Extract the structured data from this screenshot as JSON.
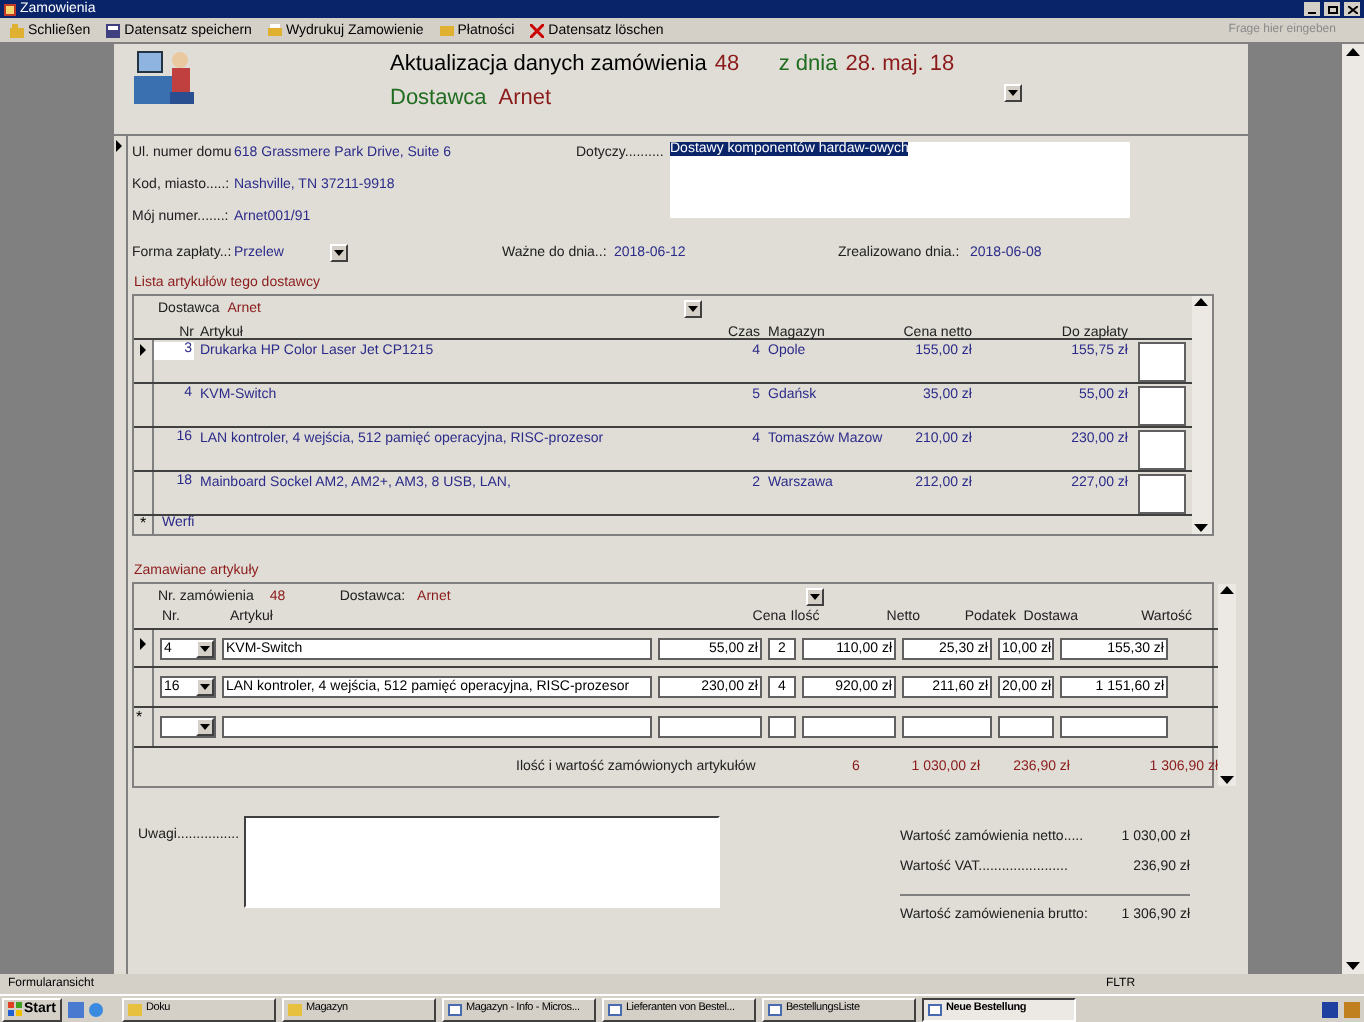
{
  "window": {
    "title": "Zamowienia"
  },
  "toolbar": {
    "buttons": [
      {
        "label": "Schließen"
      },
      {
        "label": "Datensatz speichern"
      },
      {
        "label": "Wydrukuj Zamowienie"
      },
      {
        "label": "Płatności"
      },
      {
        "label": "Datensatz löschen"
      }
    ],
    "help_placeholder": "Frage hier eingeben"
  },
  "header": {
    "title_label": "Aktualizacja danych zamówienia",
    "order_number": "48",
    "date_label": "z dnia",
    "date": "28. maj. 18",
    "supplier_label": "Dostawca",
    "supplier": "Arnet"
  },
  "fields": {
    "street": {
      "label": "Ul. numer domu",
      "value": "618 Grassmere Park Drive, Suite 6"
    },
    "city": {
      "label": "Kod, miasto.....:",
      "value": "Nashville, TN 37211-9918"
    },
    "my_number": {
      "label": "Mój numer.......:",
      "value": "Arnet001/91"
    },
    "subject": {
      "label": "Dotyczy..........",
      "value": "Dostawy komponentów hardaw-owych"
    },
    "payment": {
      "label": "Forma zapłaty..:",
      "value": "Przelew"
    },
    "valid_until": {
      "label": "Ważne do dnia..:",
      "value": "2018-06-12"
    },
    "realized": {
      "label": "Zrealizowano dnia.:",
      "value": "2018-06-08"
    }
  },
  "supplier_articles": {
    "title": "Lista artykułów tego dostawcy",
    "supplier_label": "Dostawca",
    "supplier": "Arnet",
    "columns": [
      "Nr",
      "Artykuł",
      "Czas",
      "Magazyn",
      "Cena netto",
      "Do zapłaty"
    ],
    "rows": [
      {
        "nr": "3",
        "article": "Drukarka HP Color Laser Jet CP1215",
        "time": "4",
        "warehouse": "Opole",
        "net": "155,00 zł",
        "gross": "155,75 zł",
        "selected": true
      },
      {
        "nr": "4",
        "article": "KVM-Switch",
        "time": "5",
        "warehouse": "Gdańsk",
        "net": "35,00 zł",
        "gross": "55,00 zł",
        "selected": false
      },
      {
        "nr": "16",
        "article": "LAN kontroler, 4 wejścia, 512 pamięć operacyjna, RISC-prozesor",
        "time": "4",
        "warehouse": "Tomaszów Mazow",
        "net": "210,00 zł",
        "gross": "230,00 zł",
        "selected": false
      },
      {
        "nr": "18",
        "article": "Mainboard Sockel AM2, AM2+, AM3,  8 USB, LAN,",
        "time": "2",
        "warehouse": "Warszawa",
        "net": "212,00 zł",
        "gross": "227,00 zł",
        "selected": false
      }
    ],
    "new_row_marker": "*",
    "new_row_text": "Werfi"
  },
  "ordered_articles": {
    "title": "Zamawiane artykuły",
    "order_no_label": "Nr. zamówienia",
    "order_no": "48",
    "supplier_label": "Dostawca:",
    "supplier": "Arnet",
    "columns": [
      "Nr.",
      "Artykuł",
      "Cena",
      "Ilość",
      "Netto",
      "Podatek",
      "Dostawa",
      "Wartość"
    ],
    "rows": [
      {
        "nr": "4",
        "article": "KVM-Switch",
        "price": "55,00 zł",
        "qty": "2",
        "net": "110,00 zł",
        "tax": "25,30 zł",
        "delivery": "10,00 zł",
        "value": "155,30 zł",
        "selected": true
      },
      {
        "nr": "16",
        "article": "LAN kontroler, 4 wejścia, 512 pamięć operacyjna, RISC-prozesor",
        "price": "230,00 zł",
        "qty": "4",
        "net": "920,00 zł",
        "tax": "211,60 zł",
        "delivery": "20,00 zł",
        "value": "1 151,60 zł",
        "selected": false
      }
    ],
    "new_row_marker": "*",
    "totals": {
      "label": "Ilość  i wartość  zamówionych artykułów",
      "qty": "6",
      "net": "1 030,00 zł",
      "tax": "236,90 zł",
      "value": "1 306,90 zł"
    }
  },
  "notes": {
    "label": "Uwagi................"
  },
  "summary": [
    {
      "label": "Wartość  zamówienia netto.....",
      "value": "1 030,00 zł"
    },
    {
      "label": "Wartość VAT.......................",
      "value": "236,90 zł"
    },
    {
      "label": "Wartość  zamówienenia brutto:",
      "value": "1 306,90 zł"
    }
  ],
  "status_bar": {
    "left": "Formularansicht",
    "right": "FLTR"
  },
  "taskbar": {
    "start": "Start",
    "tasks": [
      {
        "label": "Doku",
        "selected": false
      },
      {
        "label": "Magazyn",
        "selected": false
      },
      {
        "label": "Magazyn - Info - Micros...",
        "selected": false
      },
      {
        "label": "Lieferanten von Bestel...",
        "selected": false
      },
      {
        "label": "BestellungsListe",
        "selected": false
      },
      {
        "label": "Neue Bestellung",
        "selected": true
      }
    ]
  }
}
